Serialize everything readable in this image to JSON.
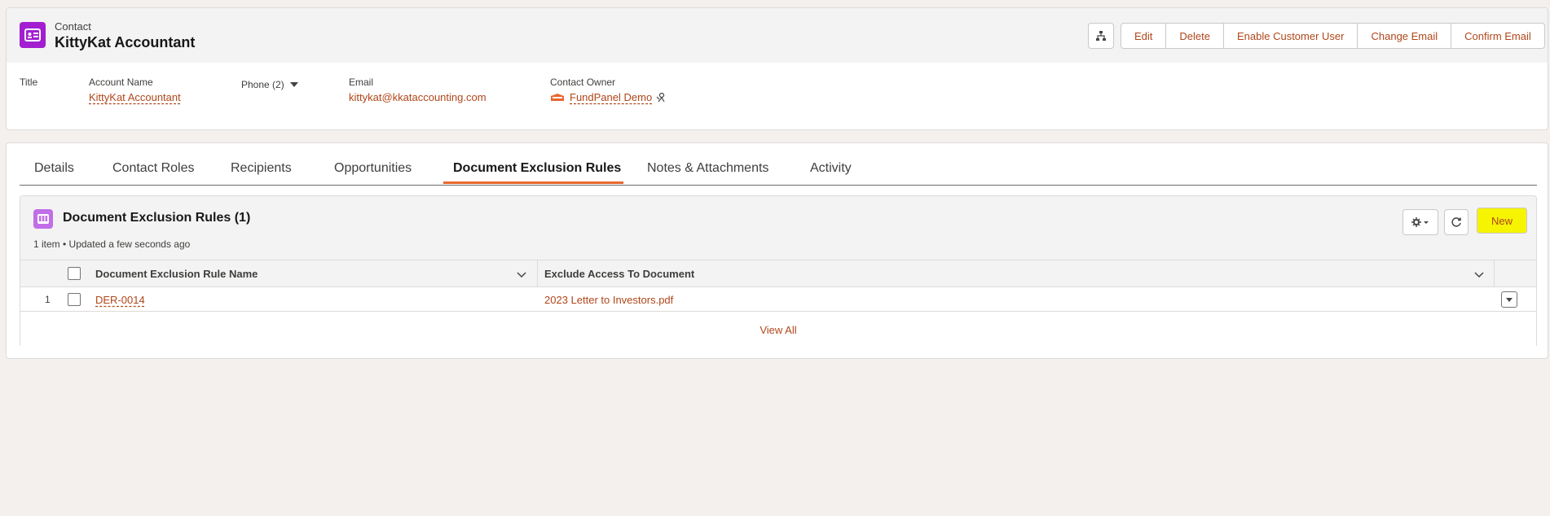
{
  "header": {
    "object_label": "Contact",
    "record_title": "KittyKat Accountant",
    "icon": "contact-card-icon",
    "buttons": [
      "Edit",
      "Delete",
      "Enable Customer User",
      "Change Email",
      "Confirm Email"
    ],
    "hierarchy_icon": "hierarchy-icon"
  },
  "highlights": {
    "title_label": "Title",
    "account_label": "Account Name",
    "account_value": "KittyKat Accountant",
    "phone_label": "Phone (2)",
    "email_label": "Email",
    "email_value": "kittykat@kkataccounting.com",
    "owner_label": "Contact Owner",
    "owner_value": "FundPanel Demo"
  },
  "tabs": {
    "items": [
      "Details",
      "Contact Roles",
      "Recipients",
      "Opportunities",
      "Document Exclusion Rules",
      "Notes & Attachments",
      "Activity"
    ],
    "active": "Document Exclusion Rules"
  },
  "related_list": {
    "title": "Document Exclusion Rules (1)",
    "subtitle": "1 item • Updated a few seconds ago",
    "new_label": "New",
    "columns": [
      "Document Exclusion Rule Name",
      "Exclude Access To Document"
    ],
    "rows": [
      {
        "num": "1",
        "name": "DER-0014",
        "document": "2023 Letter to Investors.pdf"
      }
    ],
    "view_all": "View All"
  },
  "colors": {
    "accent_link": "#b0461a",
    "contact_icon": "#a31ed1",
    "related_icon": "#c16ee8",
    "highlight": "#f6f400",
    "active_tab_underline": "#e8672e"
  }
}
